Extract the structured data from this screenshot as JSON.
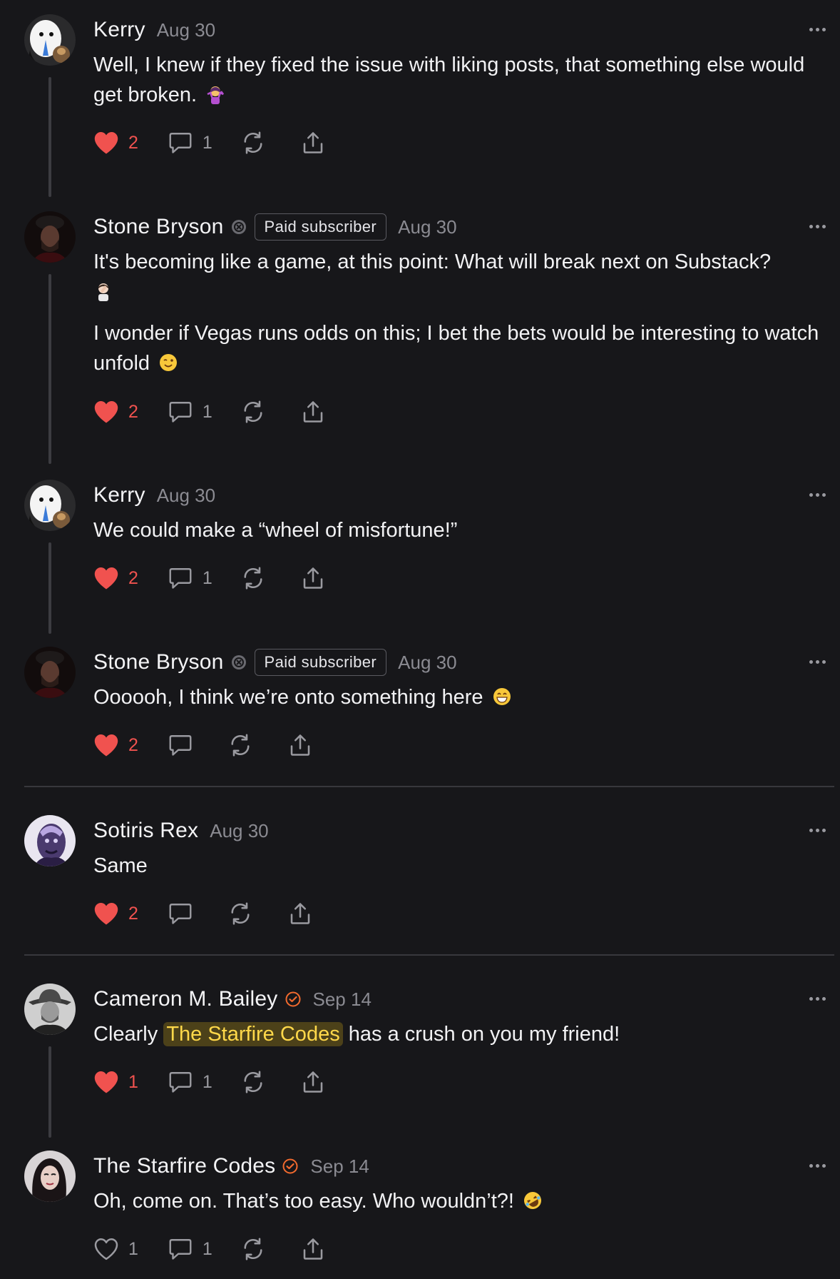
{
  "colors": {
    "background": "#17171a",
    "like_active": "#f0524f",
    "muted": "#8b8b92",
    "verified": "#f26a2e",
    "mention_bg": "#4c4119",
    "mention_text": "#ffd84a"
  },
  "comments": [
    {
      "author": "Kerry",
      "date": "Aug 30",
      "paragraphs": [
        "Well, I knew if they fixed the issue with liking posts, that something else would get broken."
      ],
      "emoji": "woman-shrugging-emoji",
      "likes": "2",
      "liked": true,
      "replies": "1",
      "has_thread_line": true
    },
    {
      "author": "Stone Bryson",
      "badge": "paid-subscriber-badge-icon",
      "tag": "Paid subscriber",
      "date": "Aug 30",
      "paragraphs": [
        "It's becoming like a game, at this point: What will break next on Substack?",
        "I wonder if Vegas runs odds on this; I bet the bets would be interesting to watch unfold"
      ],
      "emoji_1": "person-facepalming-emoji",
      "emoji_2": "winking-face-emoji",
      "likes": "2",
      "liked": true,
      "replies": "1",
      "has_thread_line": true
    },
    {
      "author": "Kerry",
      "date": "Aug 30",
      "paragraphs": [
        "We could make a “wheel of misfortune!”"
      ],
      "likes": "2",
      "liked": true,
      "replies": "1",
      "has_thread_line": true
    },
    {
      "author": "Stone Bryson",
      "badge": "paid-subscriber-badge-icon",
      "tag": "Paid subscriber",
      "date": "Aug 30",
      "paragraphs": [
        "Oooooh, I think we’re onto something here"
      ],
      "emoji": "grinning-face-emoji",
      "likes": "2",
      "liked": true,
      "replies": ""
    },
    {
      "author": "Sotiris Rex",
      "date": "Aug 30",
      "paragraphs": [
        "Same"
      ],
      "likes": "2",
      "liked": true,
      "replies": ""
    },
    {
      "author": "Cameron M. Bailey",
      "badge": "verified-check-icon",
      "date": "Sep 14",
      "text_before": "Clearly",
      "mention": "The Starfire Codes",
      "text_after": "has a crush on you my friend!",
      "likes": "1",
      "liked": true,
      "replies": "1",
      "has_thread_line": true
    },
    {
      "author": "The Starfire Codes",
      "badge": "verified-check-icon",
      "date": "Sep 14",
      "paragraphs": [
        "Oh, come on. That’s too easy. Who wouldn’t?!"
      ],
      "emoji": "rolling-on-floor-laughing-emoji",
      "likes": "1",
      "liked": false,
      "replies": "1"
    }
  ]
}
